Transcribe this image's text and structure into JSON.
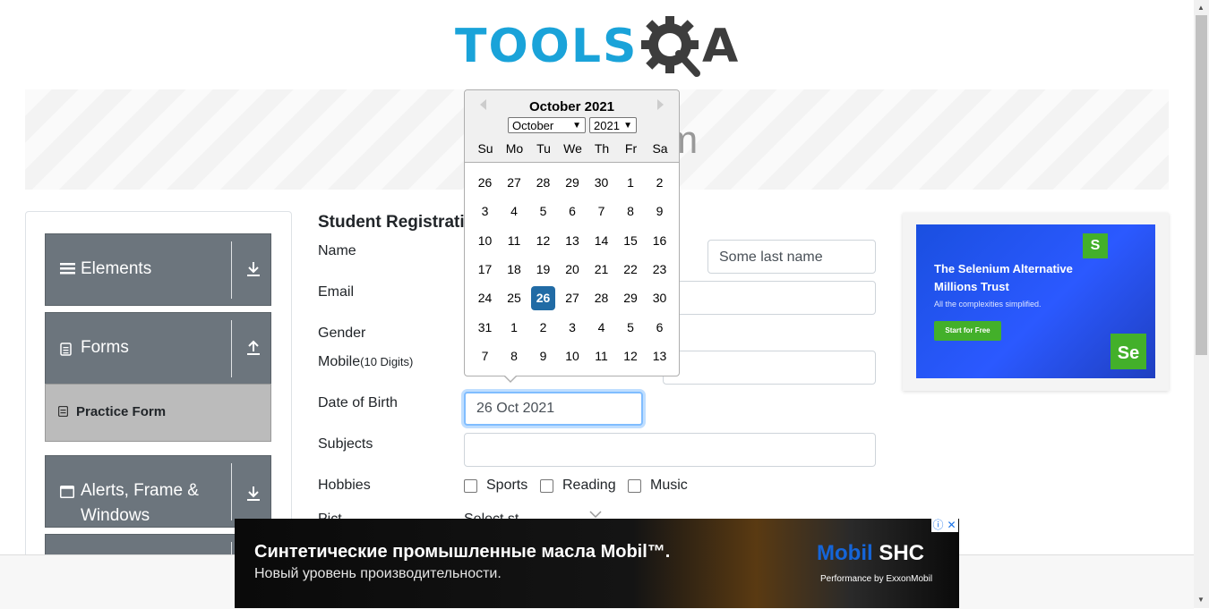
{
  "logo": {
    "text": "TOOLS",
    "gear_letter": "Q",
    "tail": "A"
  },
  "banner": {
    "title_visible": "rm"
  },
  "menu": {
    "groups": [
      {
        "label": "Elements",
        "icon": "hamburger-icon"
      },
      {
        "label": "Forms",
        "icon": "form-icon"
      },
      {
        "label": "Alerts, Frame & Windows",
        "icon": "window-icon"
      }
    ],
    "active_item": "Practice Form"
  },
  "form": {
    "title": "Student Registrati",
    "name_label": "Name",
    "last_name_placeholder": "Some last name",
    "email_label": "Email",
    "gender_label": "Gender",
    "mobile_label": "Mobile",
    "mobile_hint": "(10 Digits)",
    "dob_label": "Date of Birth",
    "dob_value": "26 Oct 2021",
    "subjects_label": "Subjects",
    "hobbies_label": "Hobbies",
    "hobbies": [
      "Sports",
      "Reading",
      "Music"
    ],
    "picture_label": "Pict",
    "select_text": "Select st"
  },
  "calendar": {
    "header": "October 2021",
    "month_select": "October",
    "year_select": "2021",
    "weekdays": [
      "Su",
      "Mo",
      "Tu",
      "We",
      "Th",
      "Fr",
      "Sa"
    ],
    "weeks": [
      [
        "26",
        "27",
        "28",
        "29",
        "30",
        "1",
        "2"
      ],
      [
        "3",
        "4",
        "5",
        "6",
        "7",
        "8",
        "9"
      ],
      [
        "10",
        "11",
        "12",
        "13",
        "14",
        "15",
        "16"
      ],
      [
        "17",
        "18",
        "19",
        "20",
        "21",
        "22",
        "23"
      ],
      [
        "24",
        "25",
        "26",
        "27",
        "28",
        "29",
        "30"
      ],
      [
        "31",
        "1",
        "2",
        "3",
        "4",
        "5",
        "6"
      ],
      [
        "7",
        "8",
        "9",
        "10",
        "11",
        "12",
        "13"
      ]
    ],
    "selected": "26"
  },
  "ad_right": {
    "title": "The Selenium Alternative Millions Trust",
    "subtitle": "All the complexities simplified.",
    "button": "Start for Free",
    "s_badge": "S",
    "se_badge": "Se"
  },
  "ad_bottom": {
    "line1": "Синтетические промышленные масла Mobil™.",
    "line2": "Новый уровень производительности.",
    "brand_m": "Mobil",
    "brand_rest": " SHC",
    "tagline": "Performance by ExxonMobil"
  }
}
